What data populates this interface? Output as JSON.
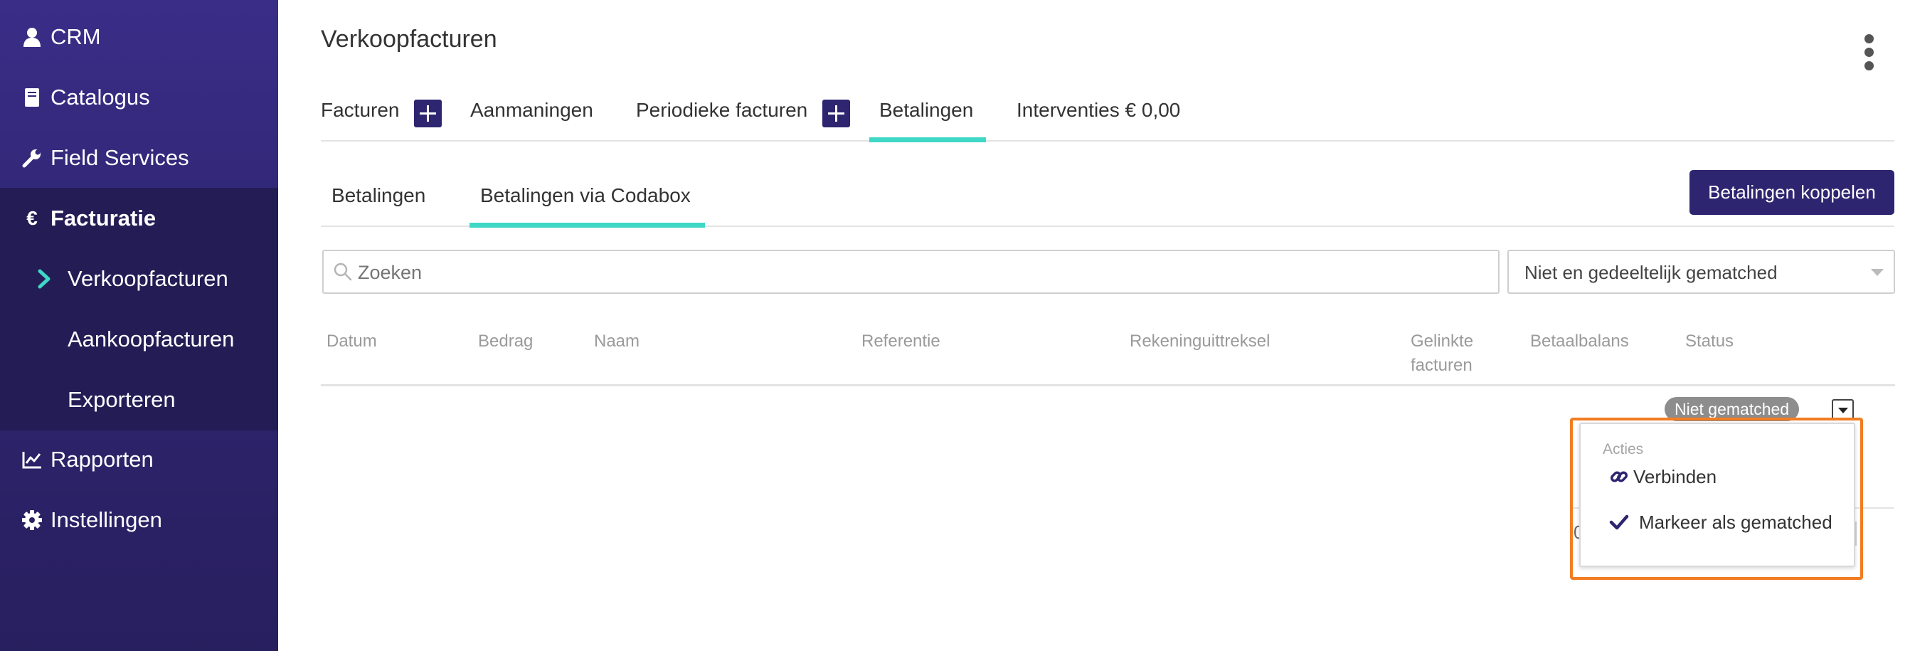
{
  "sidebar": {
    "items": [
      {
        "label": "CRM",
        "icon": "user-icon"
      },
      {
        "label": "Catalogus",
        "icon": "book-icon"
      },
      {
        "label": "Field Services",
        "icon": "wrench-icon"
      },
      {
        "label": "Facturatie",
        "icon": "euro-icon"
      },
      {
        "label": "Rapporten",
        "icon": "chart-line-icon"
      },
      {
        "label": "Instellingen",
        "icon": "gear-icon"
      }
    ],
    "euro_symbol": "€",
    "subitems": [
      {
        "label": "Verkoopfacturen",
        "active": true
      },
      {
        "label": "Aankoopfacturen"
      },
      {
        "label": "Exporteren"
      }
    ]
  },
  "header": {
    "title": "Verkoopfacturen"
  },
  "tabs": [
    {
      "label": "Facturen"
    },
    {
      "label": "Aanmaningen"
    },
    {
      "label": "Periodieke facturen"
    },
    {
      "label": "Betalingen",
      "active": true
    },
    {
      "label": "Interventies € 0,00"
    }
  ],
  "subtabs": [
    {
      "label": "Betalingen"
    },
    {
      "label": "Betalingen via Codabox",
      "active": true
    }
  ],
  "actions": {
    "link_payments": "Betalingen koppelen"
  },
  "search": {
    "placeholder": "Zoeken"
  },
  "filter": {
    "selected": "Niet en gedeeltelijk gematched"
  },
  "table": {
    "columns": [
      "Datum",
      "Bedrag",
      "Naam",
      "Referentie",
      "Rekeninguittreksel",
      "Gelinkte\nfacturen",
      "Betaalbalans",
      "Status"
    ],
    "rows": [
      {
        "status": "Niet gematched"
      }
    ],
    "partial_text": "0"
  },
  "dropdown_menu": {
    "header": "Acties",
    "items": [
      {
        "label": "Verbinden",
        "icon": "link-icon"
      },
      {
        "label": "Markeer als gematched",
        "icon": "check-icon"
      }
    ]
  },
  "colors": {
    "sidebar": "#2e2570",
    "accent": "#3fd7c6",
    "primary": "#2e2570",
    "highlight": "#f27c22",
    "badge": "#8d8d8d"
  }
}
